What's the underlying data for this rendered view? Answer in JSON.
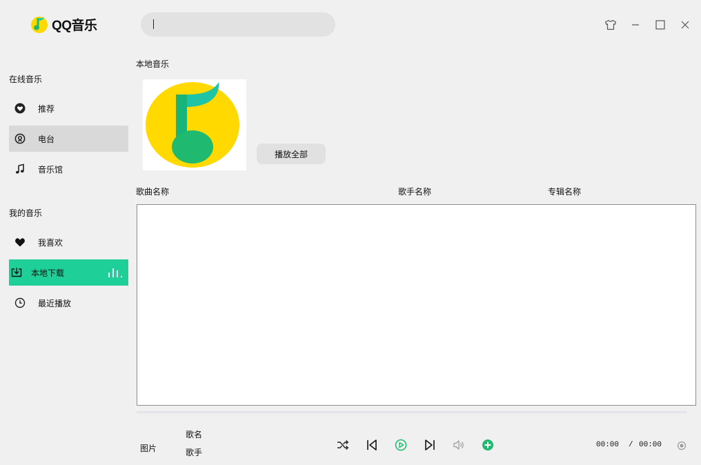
{
  "app": {
    "logo_text": "QQ音乐"
  },
  "search": {
    "value": "",
    "placeholder": ""
  },
  "sidebar": {
    "online_title": "在线音乐",
    "online_items": [
      {
        "label": "推荐",
        "icon": "heart-circle-icon"
      },
      {
        "label": "电台",
        "icon": "radio-icon"
      },
      {
        "label": "音乐馆",
        "icon": "music-note-icon"
      }
    ],
    "my_title": "我的音乐",
    "my_items": [
      {
        "label": "我喜欢",
        "icon": "heart-icon"
      },
      {
        "label": "本地下载",
        "icon": "download-icon"
      },
      {
        "label": "最近播放",
        "icon": "clock-icon"
      }
    ]
  },
  "window_controls": [
    "skin-icon",
    "minimize-icon",
    "maximize-icon",
    "close-icon"
  ],
  "main": {
    "section_title": "本地音乐",
    "play_all_label": "播放全部",
    "columns": [
      "歌曲名称",
      "歌手名称",
      "专辑名称"
    ],
    "rows": []
  },
  "player": {
    "picture_label": "图片",
    "song_label": "歌名",
    "artist_label": "歌手",
    "current_time": "00:00",
    "separator": "/",
    "total_time": "00:00"
  },
  "colors": {
    "accent": "#1ecf97",
    "logo_yellow": "#ffd900",
    "logo_green": "#1fba6f",
    "sidebar_bg": "#f0f0f0",
    "hover_bg": "#d9d9d9"
  }
}
